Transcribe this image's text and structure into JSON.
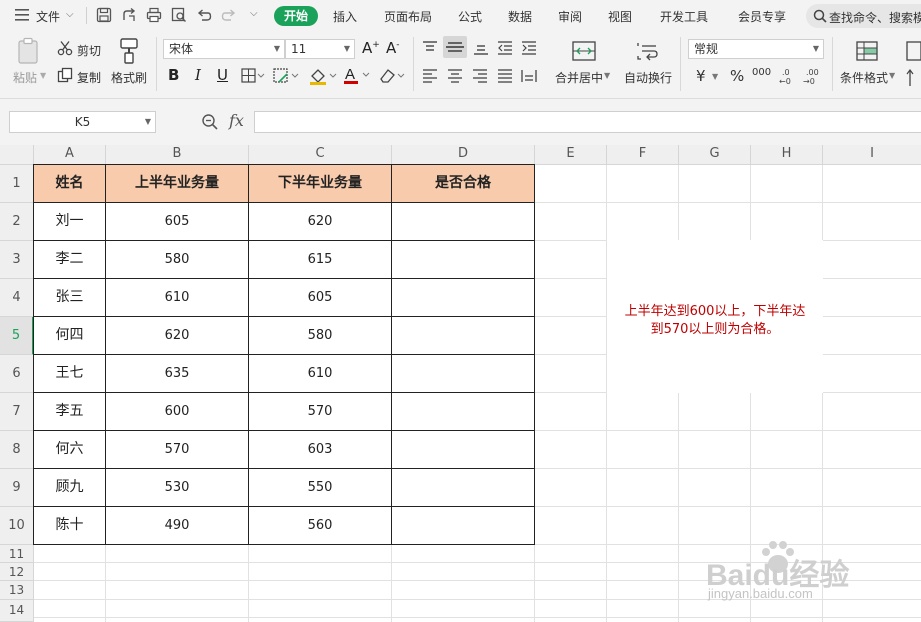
{
  "menubar": {
    "file_label": "文件",
    "tabs": [
      "开始",
      "插入",
      "页面布局",
      "公式",
      "数据",
      "审阅",
      "视图",
      "开发工具",
      "会员专享"
    ],
    "search_text": "查找命令、搜索模"
  },
  "ribbon": {
    "paste_label": "粘贴",
    "cut_label": "剪切",
    "copy_label": "复制",
    "format_painter_label": "格式刷",
    "font_name": "宋体",
    "font_size": "11",
    "merge_label": "合并居中",
    "wrap_label": "自动换行",
    "number_format": "常规",
    "conditional_label": "条件格式",
    "currency_symbol": "¥",
    "percent_symbol": "%",
    "thousand_symbol": "000"
  },
  "formula_bar": {
    "name_box": "K5",
    "fx_label": "fx",
    "formula": ""
  },
  "sheet": {
    "columns": [
      "A",
      "B",
      "C",
      "D",
      "E",
      "F",
      "G",
      "H",
      "I"
    ],
    "row_numbers": [
      "1",
      "2",
      "3",
      "4",
      "5",
      "6",
      "7",
      "8",
      "9",
      "10",
      "11",
      "12",
      "13",
      "14"
    ],
    "active_row": "5",
    "table_headers": [
      "姓名",
      "上半年业务量",
      "下半年业务量",
      "是否合格"
    ],
    "rows": [
      {
        "name": "刘一",
        "h1": "605",
        "h2": "620",
        "pass": ""
      },
      {
        "name": "李二",
        "h1": "580",
        "h2": "615",
        "pass": ""
      },
      {
        "name": "张三",
        "h1": "610",
        "h2": "605",
        "pass": ""
      },
      {
        "name": "何四",
        "h1": "620",
        "h2": "580",
        "pass": ""
      },
      {
        "name": "王七",
        "h1": "635",
        "h2": "610",
        "pass": ""
      },
      {
        "name": "李五",
        "h1": "600",
        "h2": "570",
        "pass": ""
      },
      {
        "name": "何六",
        "h1": "570",
        "h2": "603",
        "pass": ""
      },
      {
        "name": "顾九",
        "h1": "530",
        "h2": "550",
        "pass": ""
      },
      {
        "name": "陈十",
        "h1": "490",
        "h2": "560",
        "pass": ""
      }
    ],
    "note_line1": "上半年达到600以上，下半年达",
    "note_line2": "到570以上则为合格。"
  },
  "watermark": {
    "text": "Baidu经验",
    "url": "jingyan.baidu.com"
  },
  "colors": {
    "accent": "#1aa25a",
    "header_fill": "#f8cbad",
    "note_text": "#c00000"
  }
}
